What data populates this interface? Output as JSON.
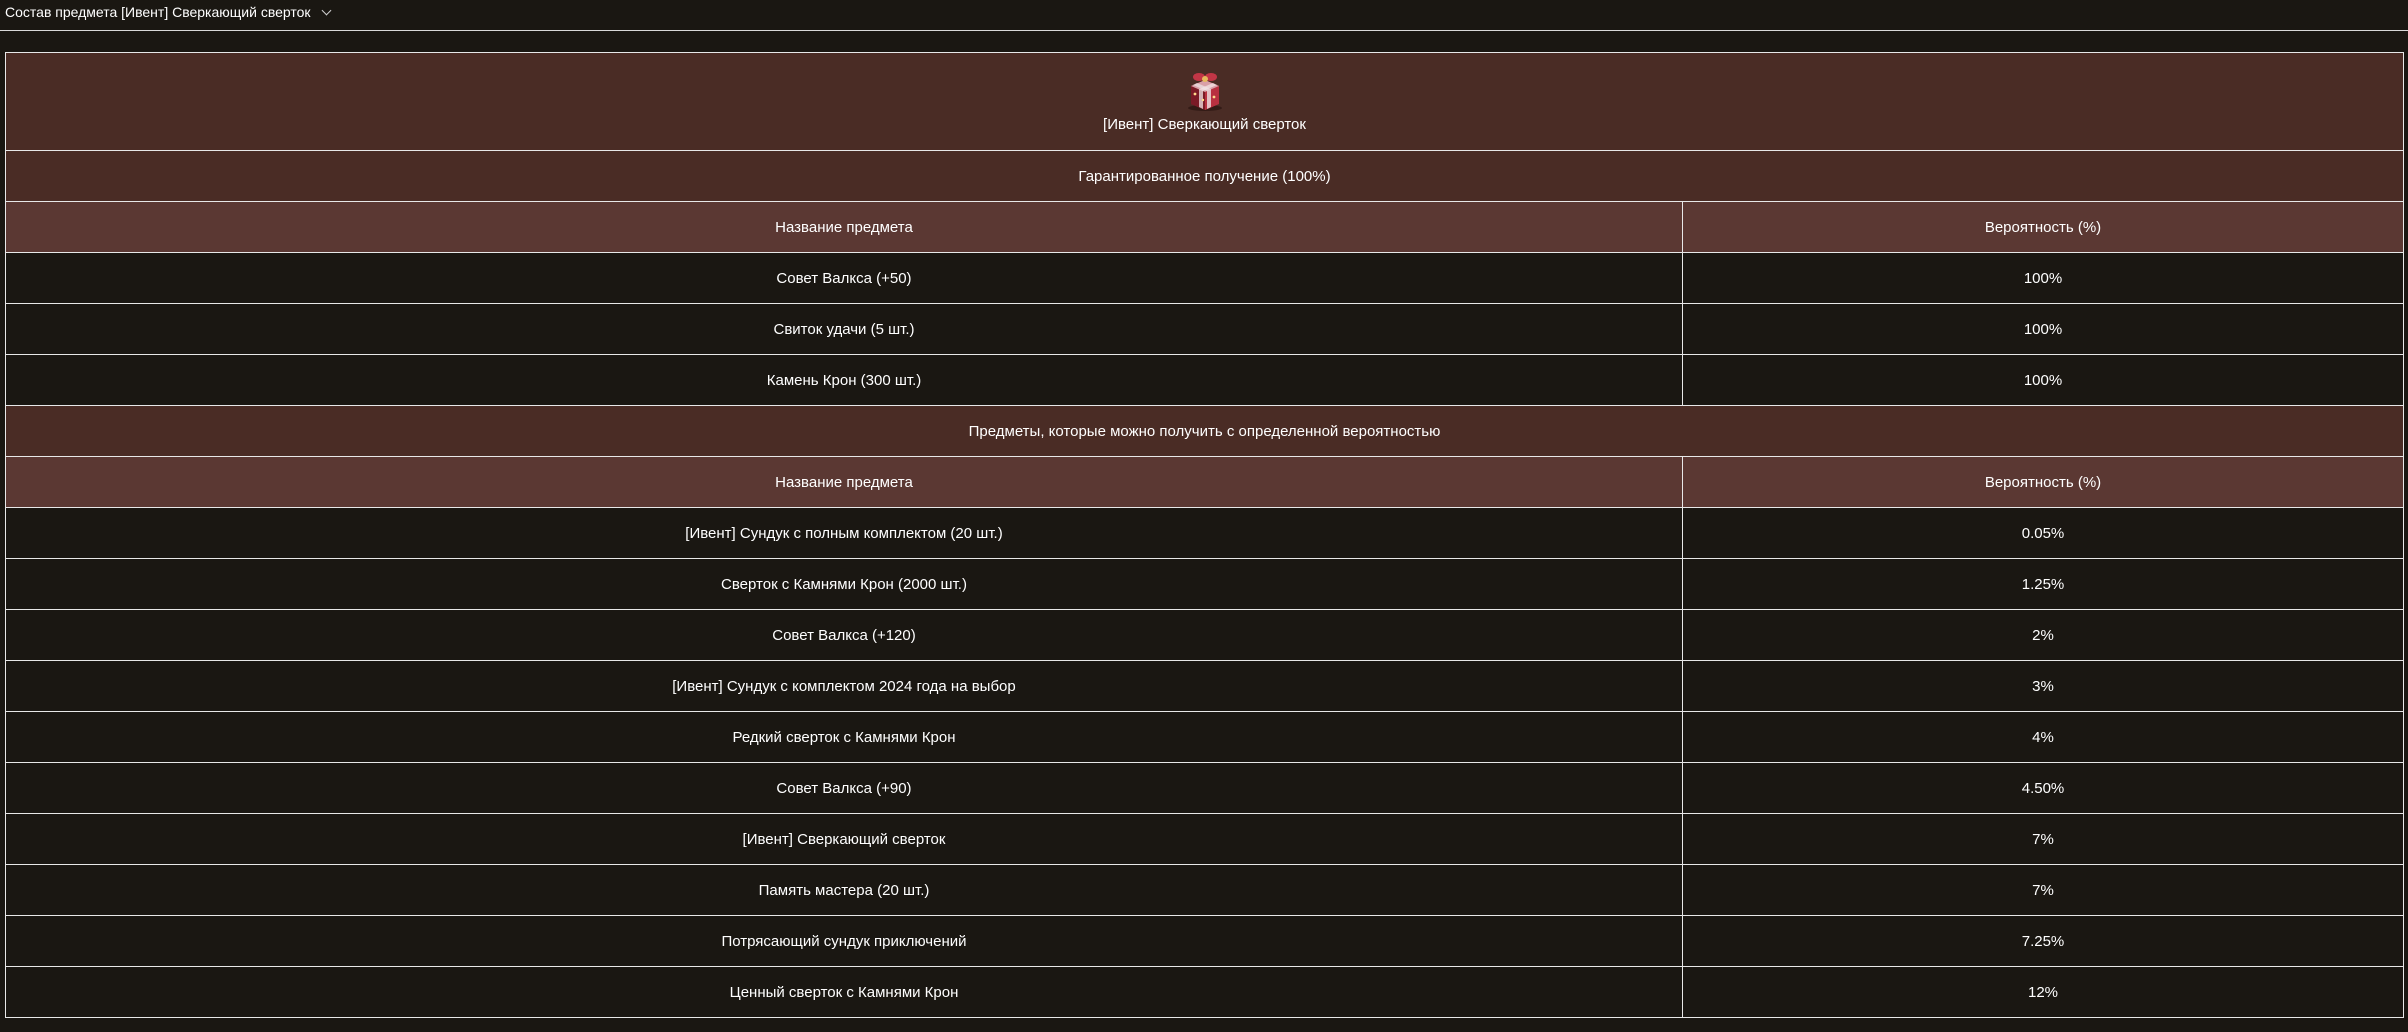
{
  "header": {
    "title": "Состав предмета [Ивент] Сверкающий сверток",
    "icon": "chevron-down-icon"
  },
  "item": {
    "name": "[Ивент] Сверкающий сверток",
    "icon": "gift-box-icon"
  },
  "sections": [
    {
      "title": "Гарантированное получение (100%)",
      "columns": [
        "Название предмета",
        "Вероятность (%)"
      ],
      "rows": [
        [
          "Совет Валкса (+50)",
          "100%"
        ],
        [
          "Свиток удачи (5 шт.)",
          "100%"
        ],
        [
          "Камень Крон (300 шт.)",
          "100%"
        ]
      ]
    },
    {
      "title": "Предметы, которые можно получить с определенной вероятностью",
      "columns": [
        "Название предмета",
        "Вероятность (%)"
      ],
      "rows": [
        [
          "[Ивент] Сундук с полным комплектом (20 шт.)",
          "0.05%"
        ],
        [
          "Сверток с Камнями Крон (2000 шт.)",
          "1.25%"
        ],
        [
          "Совет Валкса (+120)",
          "2%"
        ],
        [
          "[Ивент] Сундук с комплектом 2024 года на выбор",
          "3%"
        ],
        [
          "Редкий сверток с Камнями Крон",
          "4%"
        ],
        [
          "Совет Валкса (+90)",
          "4.50%"
        ],
        [
          "[Ивент] Сверкающий сверток",
          "7%"
        ],
        [
          "Память мастера (20 шт.)",
          "7%"
        ],
        [
          "Потрясающий сундук приключений",
          "7.25%"
        ],
        [
          "Ценный сверток с Камнями Крон",
          "12%"
        ]
      ]
    }
  ]
}
